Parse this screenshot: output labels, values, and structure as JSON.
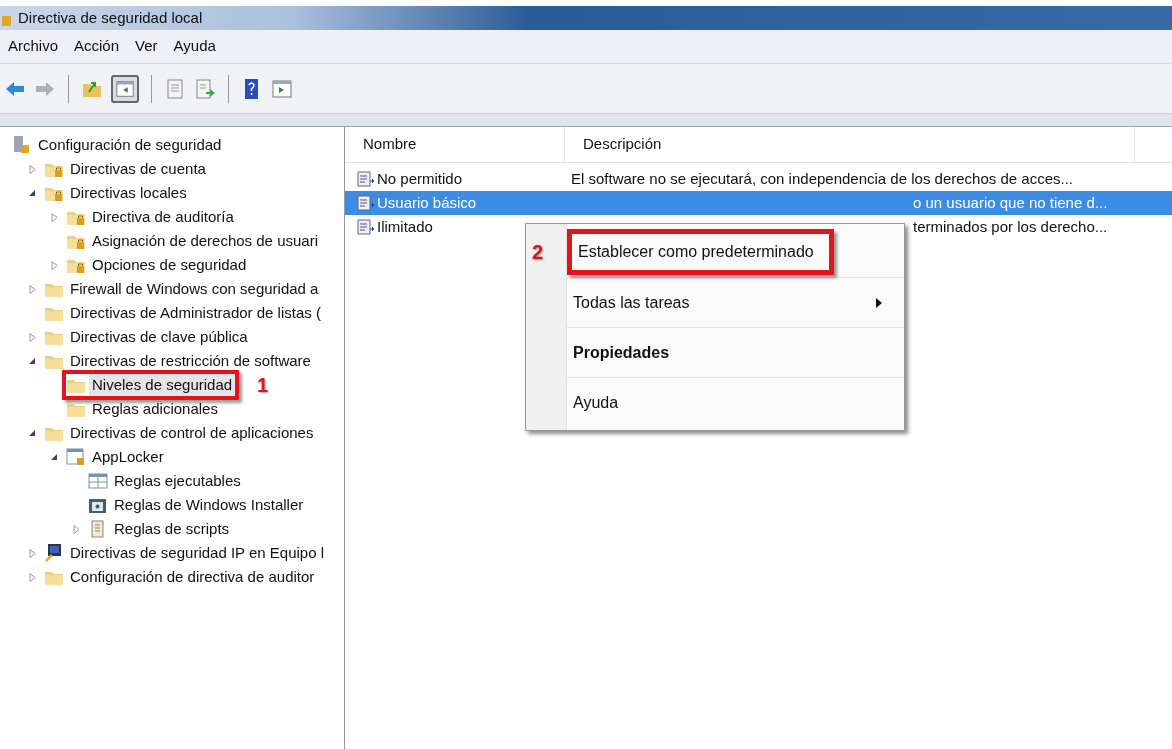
{
  "window": {
    "title": "Directiva de seguridad local"
  },
  "menu_bar": [
    "Archivo",
    "Acción",
    "Ver",
    "Ayuda"
  ],
  "toolbar": [
    {
      "kind": "back",
      "disabled": false
    },
    {
      "kind": "forward",
      "disabled": true
    },
    {
      "kind": "sep"
    },
    {
      "kind": "up-folder",
      "disabled": false
    },
    {
      "kind": "tree-pane",
      "disabled": false,
      "pressed": true
    },
    {
      "kind": "sep"
    },
    {
      "kind": "document",
      "disabled": false
    },
    {
      "kind": "export",
      "disabled": false
    },
    {
      "kind": "sep"
    },
    {
      "kind": "help",
      "disabled": false
    },
    {
      "kind": "action-pane",
      "disabled": false
    }
  ],
  "tree": [
    {
      "label": "Configuración de seguridad",
      "kind": "root",
      "children": [
        {
          "label": "Directivas de cuenta",
          "kind": "lock-folder",
          "expanded": false
        },
        {
          "label": "Directivas locales",
          "kind": "lock-folder",
          "expanded": true,
          "children": [
            {
              "label": "Directiva de auditoría",
              "kind": "lock-folder",
              "expanded": false
            },
            {
              "label": "Asignación de derechos de usuari",
              "kind": "lock-folder"
            },
            {
              "label": "Opciones de seguridad",
              "kind": "lock-folder",
              "expanded": false
            }
          ]
        },
        {
          "label": "Firewall de Windows con seguridad a",
          "kind": "folder",
          "expanded": false
        },
        {
          "label": "Directivas de Administrador de listas (",
          "kind": "folder"
        },
        {
          "label": "Directivas de clave pública",
          "kind": "folder",
          "expanded": false
        },
        {
          "label": "Directivas de restricción de software",
          "kind": "folder",
          "expanded": true,
          "children": [
            {
              "label": "Niveles de seguridad",
              "kind": "folder",
              "selected": true,
              "callout": "1"
            },
            {
              "label": "Reglas adicionales",
              "kind": "folder",
              "selected": false
            }
          ]
        },
        {
          "label": "Directivas de control de aplicaciones",
          "kind": "folder",
          "expanded": true,
          "children": [
            {
              "label": "AppLocker",
              "kind": "applocker",
              "expanded": true,
              "children": [
                {
                  "label": "Reglas ejecutables",
                  "kind": "rules"
                },
                {
                  "label": "Reglas de Windows Installer",
                  "kind": "installer"
                },
                {
                  "label": "Reglas de scripts",
                  "kind": "script",
                  "expanded": false
                }
              ]
            }
          ]
        },
        {
          "label": "Directivas de seguridad IP en Equipo l",
          "kind": "network",
          "expanded": false
        },
        {
          "label": "Configuración de directiva de auditor",
          "kind": "folder",
          "expanded": false
        }
      ]
    }
  ],
  "list": {
    "columns": [
      "Nombre",
      "Descripción"
    ],
    "rows": [
      {
        "name": "No permitido",
        "description": "El software no se ejecutará, con independencia de los derechos de acces...",
        "selected": false
      },
      {
        "name": "Usuario básico",
        "description": "o un usuario que no tiene d...",
        "selected": true
      },
      {
        "name": "Ilimitado",
        "description": "terminados por los derecho...",
        "selected": false
      }
    ]
  },
  "context_menu": [
    {
      "label": "Establecer como predeterminado",
      "callout": "2",
      "bold": false,
      "submenu": false
    },
    {
      "label": "Todas las tareas",
      "bold": false,
      "submenu": true
    },
    {
      "label": "Propiedades",
      "bold": true,
      "submenu": false
    },
    {
      "label": "Ayuda",
      "bold": false,
      "submenu": false
    }
  ]
}
